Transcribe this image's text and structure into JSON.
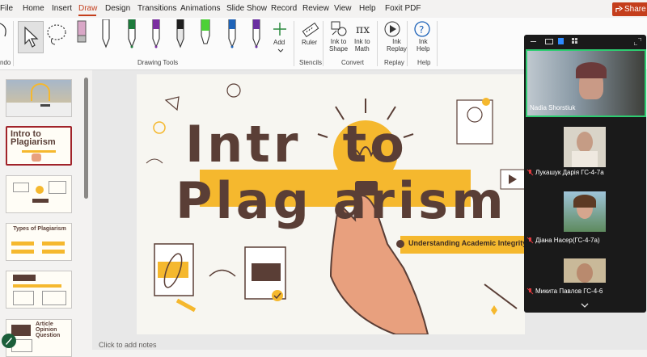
{
  "menu": {
    "tabs": [
      "File",
      "Home",
      "Insert",
      "Draw",
      "Design",
      "Transitions",
      "Animations",
      "Slide Show",
      "Record",
      "Review",
      "View",
      "Help",
      "Foxit PDF"
    ],
    "active_tab": "Draw",
    "share_label": "Share"
  },
  "ribbon": {
    "undo_group_label": "ndo",
    "drawing_tools_label": "Drawing Tools",
    "add_label": "Add",
    "ruler_label": "Ruler",
    "stencils_label": "Stencils",
    "ink_to_shape_label": "Ink to\nShape",
    "ink_to_math_label": "Ink to\nMath",
    "convert_label": "Convert",
    "ink_replay_label": "Ink\nReplay",
    "replay_label": "Replay",
    "ink_help_label": "Ink\nHelp",
    "help_label": "Help",
    "pen_colors": [
      "#ffffff",
      "#ffffff",
      "#1d7a3b",
      "#7b2fa1",
      "#1f1f1f",
      "#4cd137",
      "#1e63b8",
      "#6a2fa1"
    ]
  },
  "slides_pane": {
    "thumb_numbers": [
      "1",
      "2",
      "3",
      "4",
      "5",
      "6"
    ],
    "thumb_titles": [
      "",
      "Intro to Plagiarism",
      "",
      "Types of Plagiarism",
      "",
      "Article Opinion Question"
    ]
  },
  "slide": {
    "title_line1": "Intr  to",
    "title_line2": "Plag arism",
    "subtitle": "Understanding Academic Integrity and"
  },
  "notes_placeholder": "Click to add notes",
  "zoom": {
    "participants": [
      {
        "name": "Nadia Shorstiuk",
        "muted": false
      },
      {
        "name": "Лукашук Дарія ГС-4-7а",
        "muted": true
      },
      {
        "name": "Діана Насер(ГС-4-7а)",
        "muted": true
      },
      {
        "name": "Микита Павлов ГС-4-6",
        "muted": true
      }
    ],
    "colors": {
      "active_border": "#2ecc71",
      "muted_icon": "#e0393e",
      "panel_bg": "#1a1a1a"
    }
  },
  "colors": {
    "accent": "#c43e1c",
    "title_brown": "#5a3e36",
    "highlight_yellow": "#f5b82e"
  }
}
